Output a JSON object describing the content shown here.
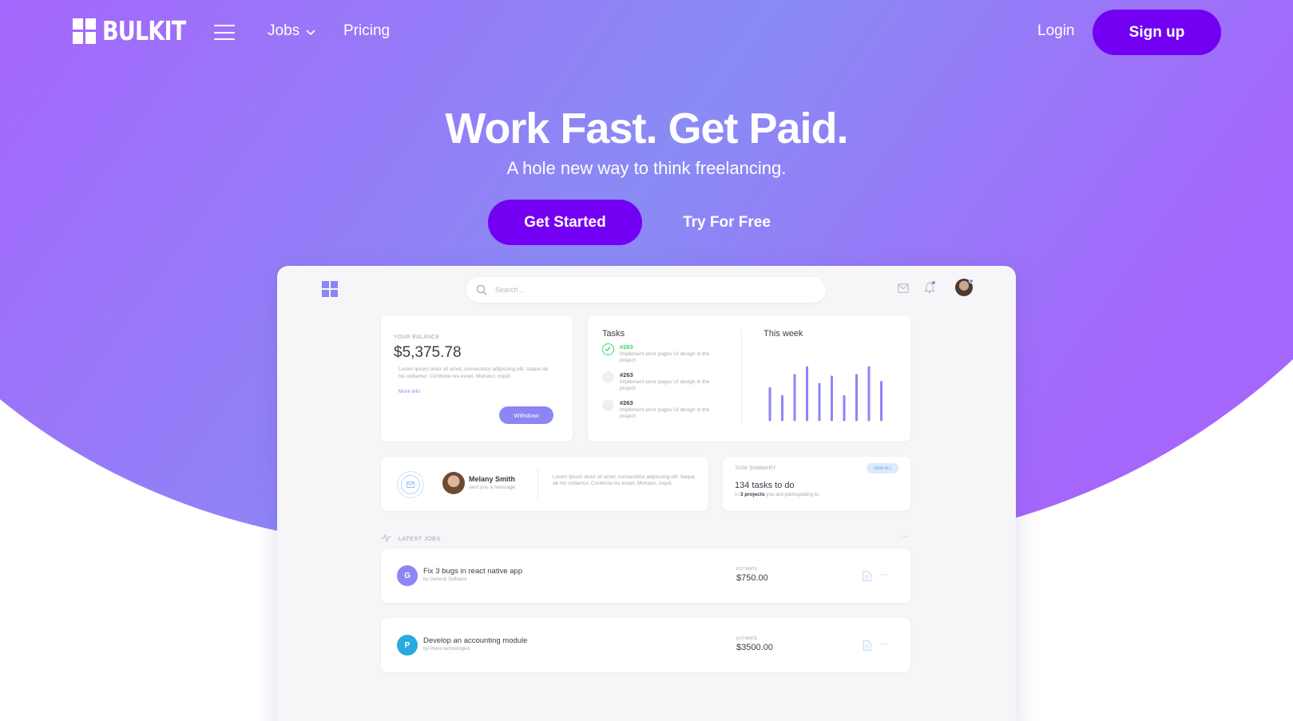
{
  "brand": {
    "name": "BULKIT"
  },
  "nav": {
    "jobs_label": "Jobs",
    "pricing_label": "Pricing",
    "login_label": "Login",
    "signup_label": "Sign up"
  },
  "hero": {
    "title": "Work Fast. Get Paid.",
    "subtitle": "A hole new way to think freelancing.",
    "primary_cta": "Get Started",
    "secondary_cta": "Try For Free"
  },
  "colors": {
    "gradient_start": "#a566fb",
    "gradient_end": "#7f99f2",
    "accent": "#7400f4",
    "mock_accent": "#8e85f5",
    "success": "#3cd36f"
  },
  "dashboard": {
    "search_placeholder": "Search ...",
    "balance": {
      "label": "YOUR BALANCE",
      "value": "$5,375.78",
      "text": "Lorem ipsum dolor sit amet, consectetur adipiscing elit. Itaque ab his ordiamur. Confecta res esset. Moriatur, inquit.",
      "more": "More info",
      "button": "Withdraw"
    },
    "tasks": {
      "title": "Tasks",
      "items": [
        {
          "number": "#263",
          "text": "Implement error pages UI design in the project",
          "done": true
        },
        {
          "number": "#263",
          "text": "Implement error pages UI design in the project",
          "done": false
        },
        {
          "number": "#263",
          "text": "Implement error pages UI design in the project",
          "done": false
        }
      ]
    },
    "week": {
      "title": "This week",
      "bar_levels": [
        0.6,
        0.45,
        0.85,
        1.0,
        0.68,
        0.82,
        0.45,
        0.85,
        1.0,
        0.72
      ]
    },
    "message": {
      "name": "Melany Smith",
      "subtitle": "sent you a message",
      "text": "Lorem ipsum dolor sit amet, consectetur adipiscing elit. Itaque ab his ordiamur. Confecta res esset. Moriatur, inquit."
    },
    "summary": {
      "label": "TASK SUMMARY",
      "badge": "VIEW ALL",
      "value": "134 tasks to do",
      "text_pre": "in",
      "text_bold": "3 projects",
      "text_post": "you are participating to"
    },
    "latest_jobs": {
      "label": "LATEST JOBS",
      "more": "···",
      "jobs": [
        {
          "initial": "G",
          "color": "#8e85f5",
          "title": "Fix 3 bugs in react native app",
          "by": "by General Software",
          "estimate_label": "ESTIMATE",
          "estimate": "$750.00",
          "more": "···"
        },
        {
          "initial": "P",
          "color": "#2aa9e0",
          "title": "Develop an accounting module",
          "by": "by Press technologies",
          "estimate_label": "ESTIMATE",
          "estimate": "$3500.00",
          "more": "···"
        }
      ]
    }
  }
}
